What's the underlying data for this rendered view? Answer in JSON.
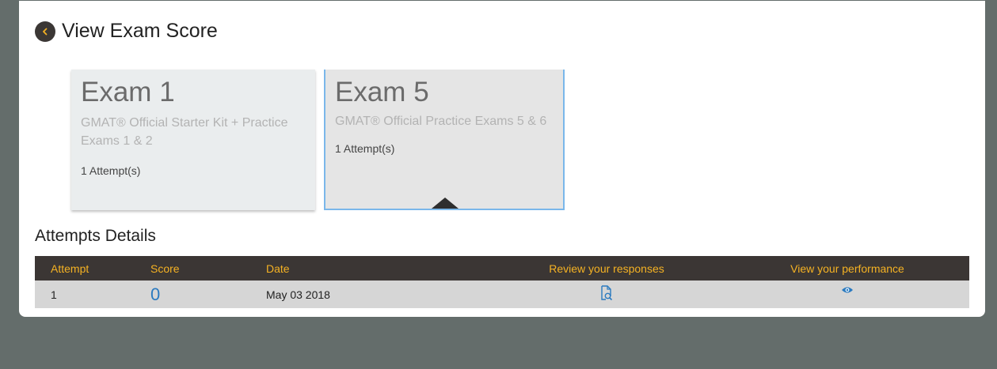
{
  "header": {
    "title": "View Exam Score",
    "back_icon": "chevron-left-icon"
  },
  "exams": [
    {
      "title": "Exam 1",
      "subtitle": "GMAT® Official Starter Kit + Practice Exams 1 & 2",
      "attempts": "1 Attempt(s)"
    },
    {
      "title": "Exam 5",
      "subtitle": "GMAT® Official Practice Exams 5 & 6",
      "attempts": "1 Attempt(s)"
    }
  ],
  "attempts_section": {
    "title": "Attempts Details"
  },
  "table": {
    "headers": {
      "attempt": "Attempt",
      "score": "Score",
      "date": "Date",
      "review": "Review your responses",
      "performance": "View your performance"
    },
    "rows": [
      {
        "attempt": "1",
        "score": "0",
        "date": "May 03 2018",
        "review_icon": "document-search-icon",
        "performance_icon": "eye-icon"
      }
    ]
  },
  "colors": {
    "header_bg": "#3b3634",
    "header_text": "#f5b223",
    "score": "#2a7ac0",
    "selected_border": "#7ab7ea"
  }
}
